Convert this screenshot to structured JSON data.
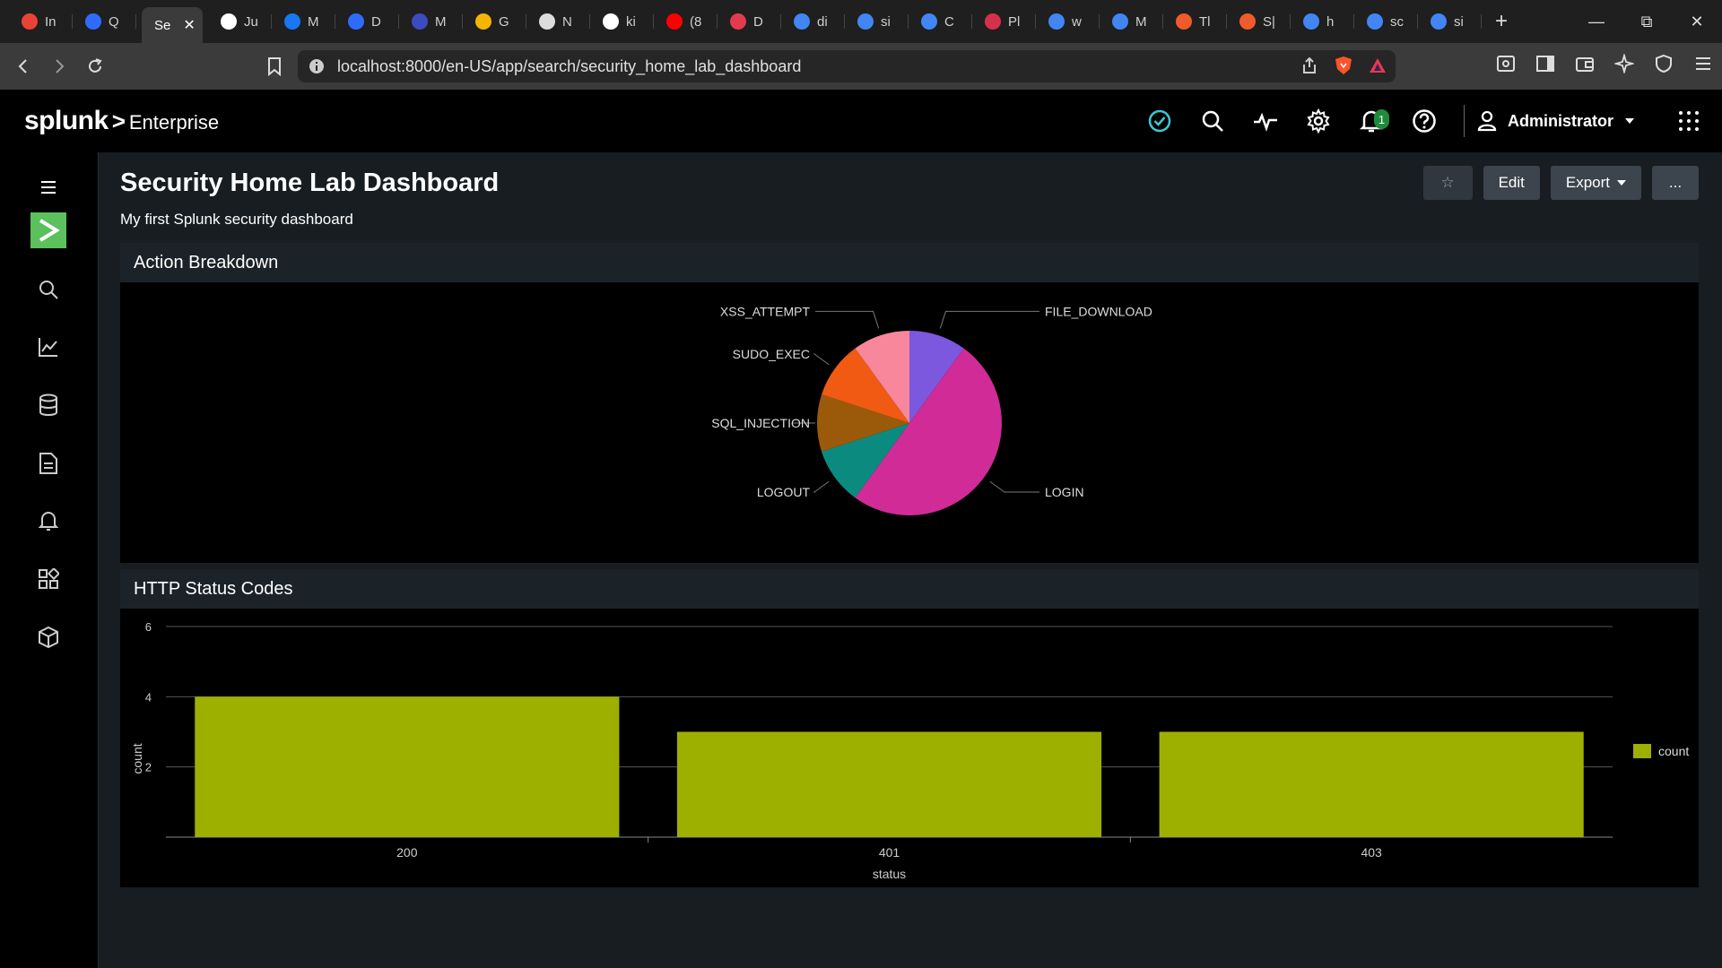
{
  "browser": {
    "tabs": [
      {
        "label": "In",
        "icon": "gmail-icon",
        "color": "#ea4335"
      },
      {
        "label": "Q",
        "icon": "gear-tab-icon",
        "color": "#2f6bff"
      },
      {
        "label": "Se",
        "icon": "",
        "color": "",
        "active": true
      },
      {
        "label": "Ju",
        "icon": "info-icon",
        "color": "#ffffff"
      },
      {
        "label": "M",
        "icon": "facebook-icon",
        "color": "#1877f2"
      },
      {
        "label": "D",
        "icon": "bing-icon",
        "color": "#2f6bff"
      },
      {
        "label": "M",
        "icon": "arrow-tab-icon",
        "color": "#3b4cc0"
      },
      {
        "label": "G",
        "icon": "bulb-icon",
        "color": "#f4b400"
      },
      {
        "label": "N",
        "icon": "slash-icon",
        "color": "#dddddd"
      },
      {
        "label": "ki",
        "icon": "github-icon",
        "color": "#ffffff"
      },
      {
        "label": "(8",
        "icon": "youtube-icon",
        "color": "#ff0000"
      },
      {
        "label": "D",
        "icon": "heart-tab-icon",
        "color": "#e33b4e"
      },
      {
        "label": "di",
        "icon": "google-icon",
        "color": "#4285f4"
      },
      {
        "label": "si",
        "icon": "google-icon",
        "color": "#4285f4"
      },
      {
        "label": "C",
        "icon": "google-icon",
        "color": "#4285f4"
      },
      {
        "label": "Pl",
        "icon": "letter-l-icon",
        "color": "#d6304a"
      },
      {
        "label": "w",
        "icon": "google-icon",
        "color": "#4285f4"
      },
      {
        "label": "M",
        "icon": "google-icon",
        "color": "#4285f4"
      },
      {
        "label": "Tl",
        "icon": "orange-circle-icon",
        "color": "#ef5b2a"
      },
      {
        "label": "S|",
        "icon": "orange-circle-icon",
        "color": "#ef5b2a"
      },
      {
        "label": "h",
        "icon": "google-icon",
        "color": "#4285f4"
      },
      {
        "label": "sc",
        "icon": "google-icon",
        "color": "#4285f4"
      },
      {
        "label": "si",
        "icon": "google-icon",
        "color": "#4285f4"
      }
    ],
    "url": "localhost:8000/en-US/app/search/security_home_lab_dashboard"
  },
  "header": {
    "logo_main": "splunk",
    "logo_sep": ">",
    "logo_product": "Enterprise",
    "notifications_count": "1",
    "user": "Administrator"
  },
  "dashboard": {
    "title": "Security Home Lab Dashboard",
    "description": "My first Splunk security dashboard",
    "buttons": {
      "star": "☆",
      "edit": "Edit",
      "export": "Export",
      "more": "..."
    }
  },
  "panels": {
    "pie_title": "Action Breakdown",
    "bar_title": "HTTP Status Codes"
  },
  "colors": {
    "accent_green": "#5cc05c",
    "bar": "#9db000",
    "check": "#3ec6d3"
  },
  "chart_data": [
    {
      "type": "pie",
      "title": "Action Breakdown",
      "slices": [
        {
          "label": "FILE_DOWNLOAD",
          "value": 1,
          "color": "#7b58de"
        },
        {
          "label": "LOGIN",
          "value": 5,
          "color": "#d12b98"
        },
        {
          "label": "LOGOUT",
          "value": 1,
          "color": "#0b8b80"
        },
        {
          "label": "SQL_INJECTION",
          "value": 1,
          "color": "#9b5a0a"
        },
        {
          "label": "SUDO_EXEC",
          "value": 1,
          "color": "#f05a13"
        },
        {
          "label": "XSS_ATTEMPT",
          "value": 1,
          "color": "#f9879b"
        }
      ]
    },
    {
      "type": "bar",
      "title": "HTTP Status Codes",
      "categories": [
        "200",
        "401",
        "403"
      ],
      "series": [
        {
          "name": "count",
          "values": [
            4,
            3,
            3
          ]
        }
      ],
      "xlabel": "status",
      "ylabel": "count",
      "ylim": [
        0,
        6
      ],
      "yticks": [
        2,
        4,
        6
      ],
      "grid": true,
      "legend": "right"
    }
  ]
}
